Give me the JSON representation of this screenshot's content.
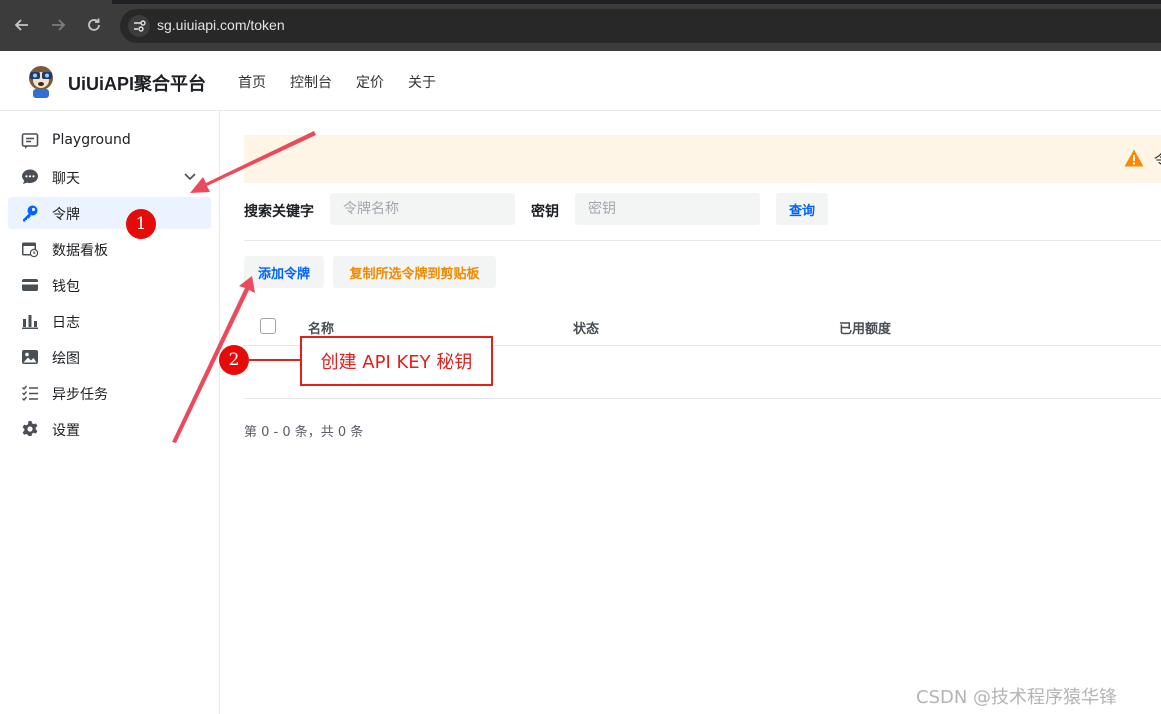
{
  "browser": {
    "url": "sg.uiuiapi.com/token",
    "icons": [
      "back-icon",
      "forward-icon",
      "reload-icon",
      "site-settings-icon"
    ]
  },
  "header": {
    "brand": "UiUiAPI聚合平台",
    "nav": [
      "首页",
      "控制台",
      "定价",
      "关于"
    ]
  },
  "sidebar": {
    "items": [
      {
        "label": "Playground",
        "icon": "message-square-icon"
      },
      {
        "label": "聊天",
        "icon": "chat-bubble-icon"
      },
      {
        "label": "令牌",
        "icon": "key-icon",
        "active": true
      },
      {
        "label": "数据看板",
        "icon": "calendar-clock-icon"
      },
      {
        "label": "钱包",
        "icon": "credit-card-icon"
      },
      {
        "label": "日志",
        "icon": "bar-chart-icon"
      },
      {
        "label": "绘图",
        "icon": "image-icon"
      },
      {
        "label": "异步任务",
        "icon": "task-list-icon"
      },
      {
        "label": "设置",
        "icon": "gear-icon"
      }
    ]
  },
  "banner": {
    "text": "令",
    "icon": "warning-icon"
  },
  "search": {
    "keyword_label": "搜索关键字",
    "keyword_placeholder": "令牌名称",
    "key_label": "密钥",
    "key_placeholder": "密钥",
    "query_button": "查询"
  },
  "actions": {
    "add_button": "添加令牌",
    "copy_button": "复制所选令牌到剪贴板"
  },
  "table": {
    "columns": [
      "名称",
      "状态",
      "已用额度"
    ]
  },
  "pager": {
    "text": "第 0 - 0 条，共 0 条"
  },
  "annotations": {
    "callout": "创建 API KEY 秘钥",
    "badge1": "1",
    "badge2": "2"
  },
  "watermark": "CSDN @技术程序猿华锋",
  "colors": {
    "accent": "#0064fa",
    "orange": "#f08a00",
    "annotation_red": "#e0211c",
    "active_bg": "#eaf3ff",
    "banner_bg": "#fff5e6"
  }
}
